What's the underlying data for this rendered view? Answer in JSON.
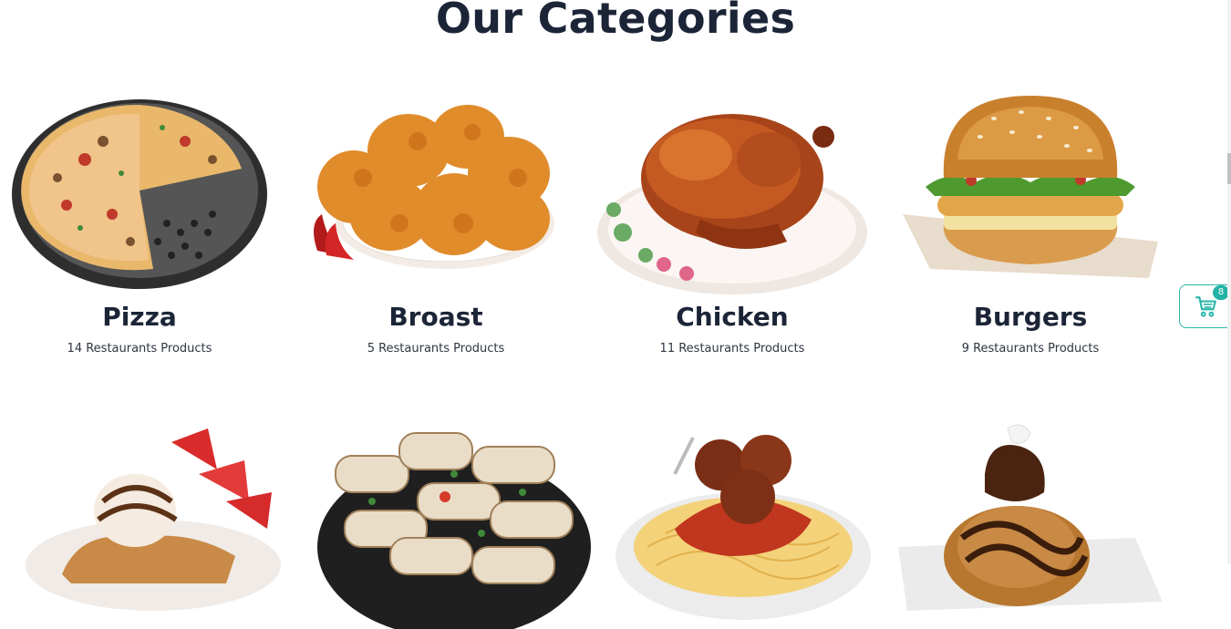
{
  "page": {
    "title": "Our Categories"
  },
  "categories": [
    {
      "name": "Pizza",
      "count": "14 Restaurants Products",
      "icon": "pizza-image"
    },
    {
      "name": "Broast",
      "count": "5 Restaurants Products",
      "icon": "broast-image"
    },
    {
      "name": "Chicken",
      "count": "11 Restaurants Products",
      "icon": "roast-chicken-image"
    },
    {
      "name": "Burgers",
      "count": "9 Restaurants Products",
      "icon": "burger-image"
    },
    {
      "name": "",
      "count": "",
      "icon": "dessert-image"
    },
    {
      "name": "",
      "count": "",
      "icon": "wraps-image"
    },
    {
      "name": "",
      "count": "",
      "icon": "spaghetti-image"
    },
    {
      "name": "",
      "count": "",
      "icon": "chocolate-dessert-image"
    }
  ],
  "cart": {
    "badge": "8",
    "icon": "cart-icon",
    "accent": "#2bb7a9"
  }
}
